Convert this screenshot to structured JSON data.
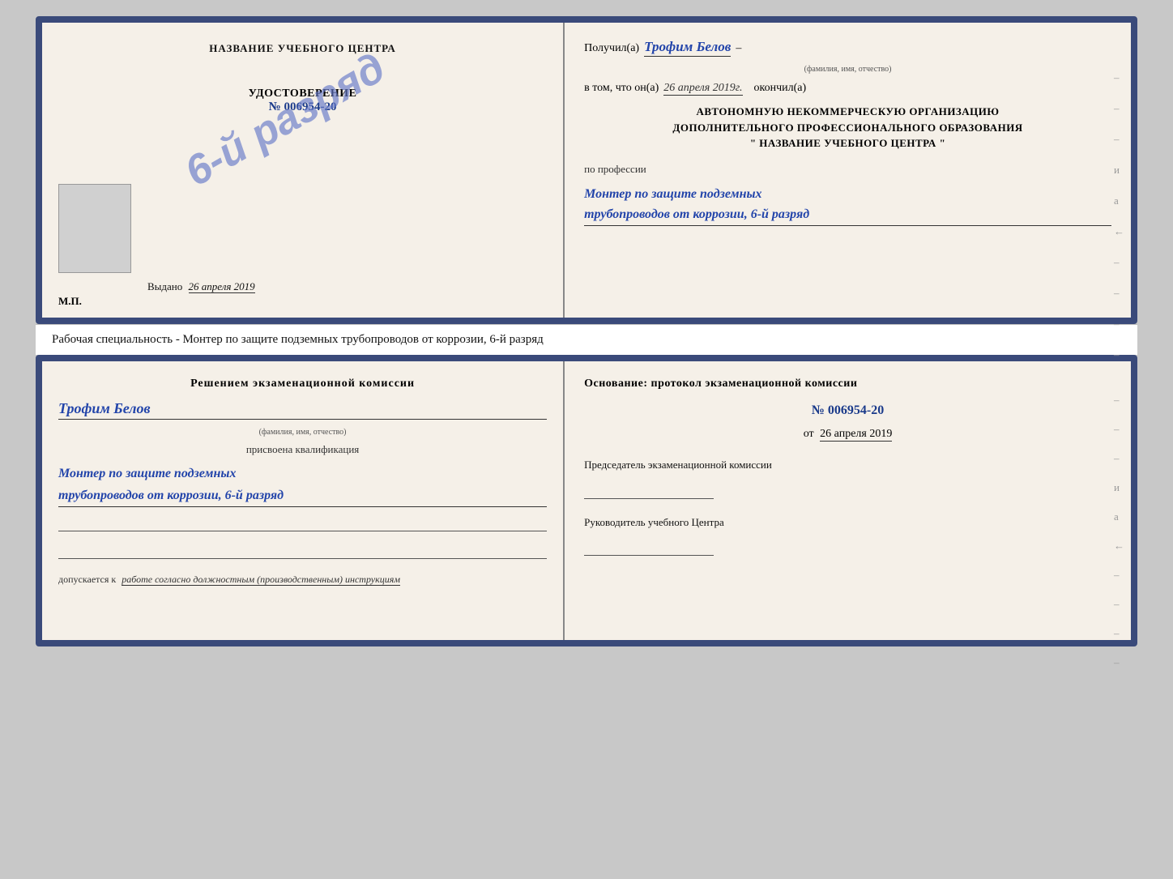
{
  "page": {
    "background_color": "#c8c8c8"
  },
  "top_cert": {
    "left": {
      "center_title": "НАЗВАНИЕ УЧЕБНОГО ЦЕНТРА",
      "stamp_text": "6-й разряд",
      "udostoverenie_label": "УДОСТОВЕРЕНИЕ",
      "number": "№ 006954-20",
      "vydano_prefix": "Выдано",
      "vydano_date": "26 апреля 2019",
      "mp_label": "М.П."
    },
    "right": {
      "poluchil_prefix": "Получил(а)",
      "poluchil_name": "Трофим Белов",
      "fio_hint": "(фамилия, имя, отчество)",
      "dash": "–",
      "vtom_prefix": "в том, что он(а)",
      "vtom_date": "26 апреля 2019г.",
      "okonchil": "окончил(а)",
      "org_line1": "АВТОНОМНУЮ НЕКОММЕРЧЕСКУЮ ОРГАНИЗАЦИЮ",
      "org_line2": "ДОПОЛНИТЕЛЬНОГО ПРОФЕССИОНАЛЬНОГО ОБРАЗОВАНИЯ",
      "org_line3": "\"   НАЗВАНИЕ УЧЕБНОГО ЦЕНТРА   \"",
      "po_professii": "по профессии",
      "prof_line1": "Монтер по защите подземных",
      "prof_line2": "трубопроводов от коррозии, 6-й разряд",
      "right_dashes": [
        "-",
        "-",
        "-",
        "и",
        "а",
        "←",
        "-",
        "-",
        "-",
        "-"
      ]
    }
  },
  "specialty_line": {
    "text": "Рабочая специальность - Монтер по защите подземных трубопроводов от коррозии, 6-й разряд"
  },
  "bottom_cert": {
    "left": {
      "reshenie_title": "Решением экзаменационной комиссии",
      "name": "Трофим Белов",
      "fio_hint": "(фамилия, имя, отчество)",
      "prisvoyena": "присвоена квалификация",
      "kvali_line1": "Монтер по защите подземных",
      "kvali_line2": "трубопроводов от коррозии, 6-й разряд",
      "dopuskaetsya_prefix": "допускается к",
      "dopuskaetsya_value": "работе согласно должностным (производственным) инструкциям"
    },
    "right": {
      "osnovanie_title": "Основание: протокол экзаменационной комиссии",
      "protocol_number": "№ 006954-20",
      "ot_prefix": "от",
      "ot_date": "26 апреля 2019",
      "predsedatel_label": "Председатель экзаменационной комиссии",
      "rukovoditel_label": "Руководитель учебного Центра",
      "right_dashes": [
        "-",
        "-",
        "-",
        "и",
        "а",
        "←",
        "-",
        "-",
        "-",
        "-"
      ]
    }
  }
}
